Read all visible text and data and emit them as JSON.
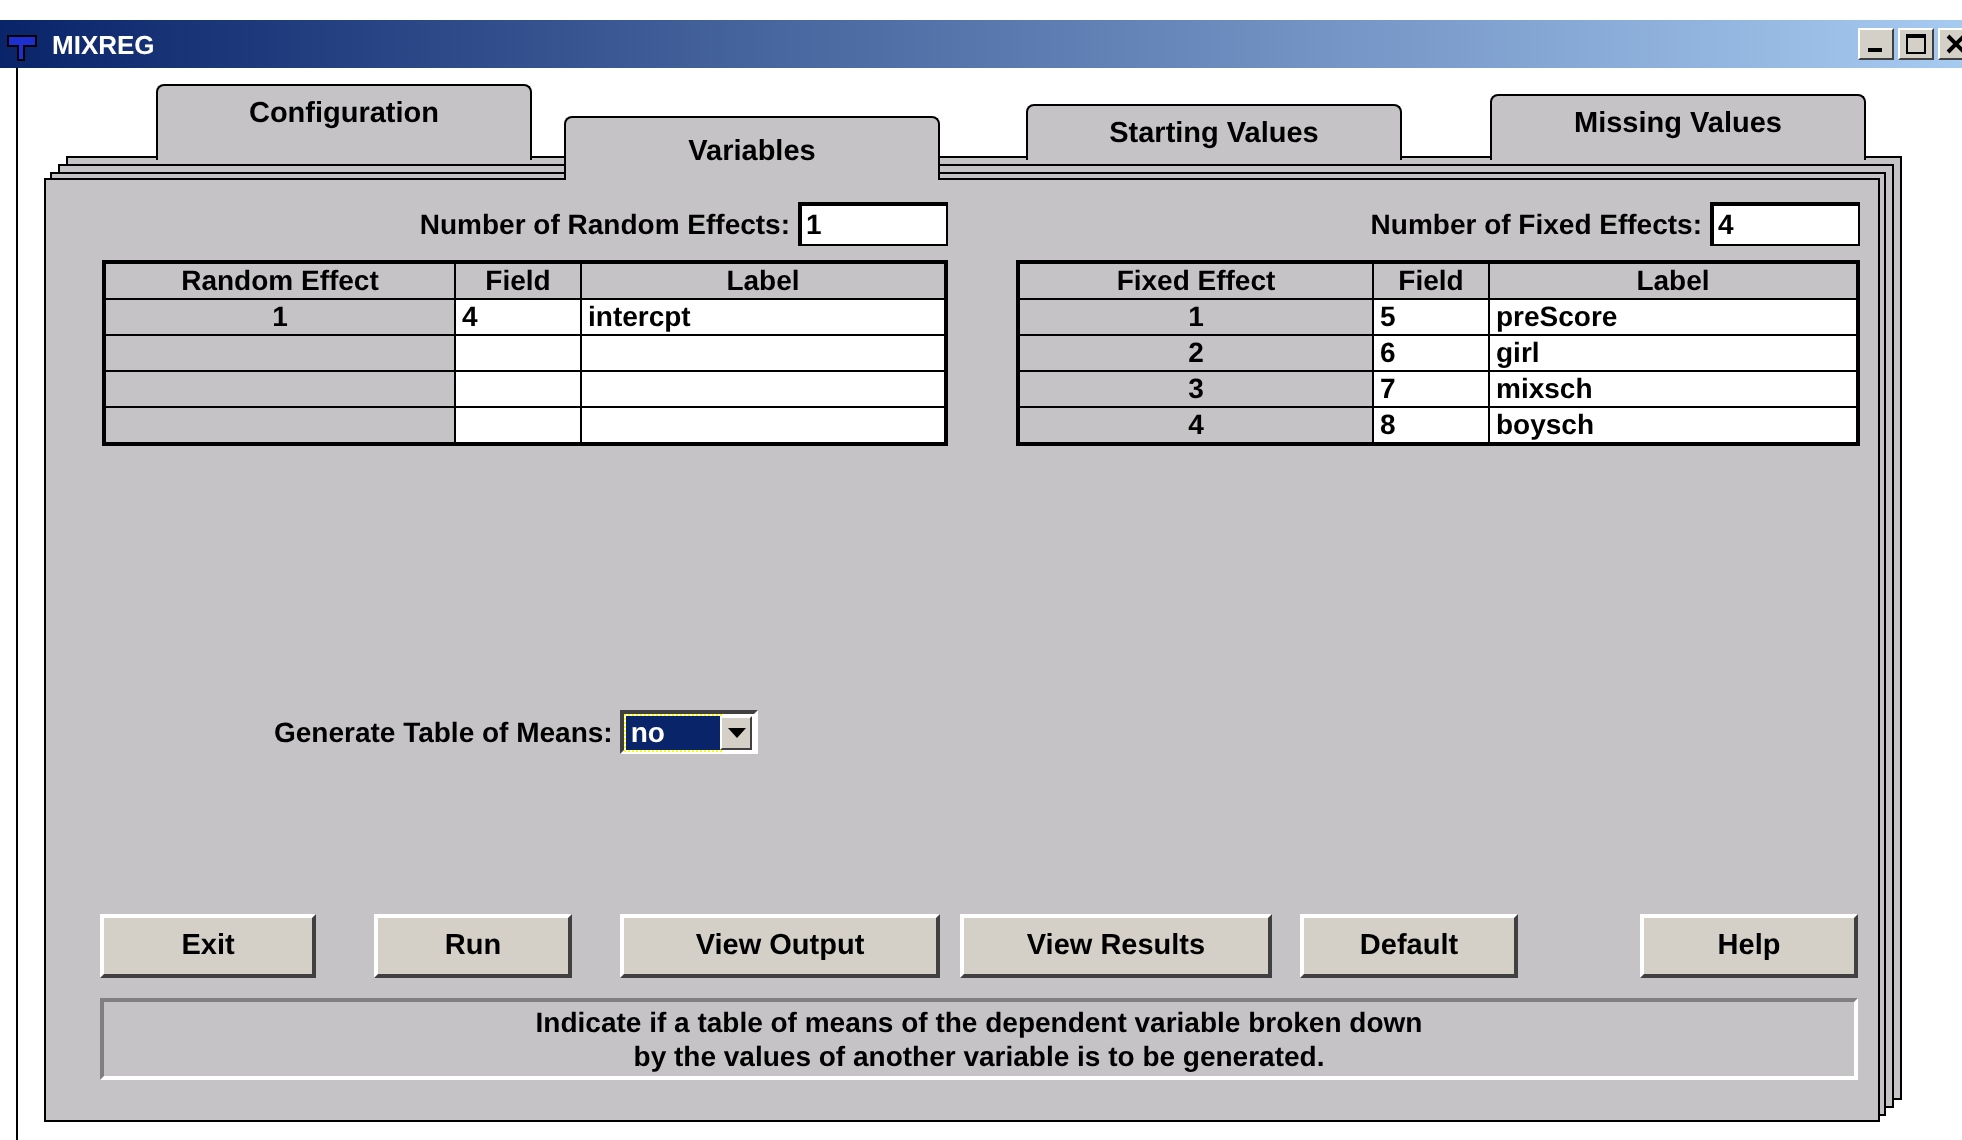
{
  "window": {
    "title": "MIXREG"
  },
  "tabs": [
    {
      "label": "Configuration",
      "selected": false
    },
    {
      "label": "Variables",
      "selected": true
    },
    {
      "label": "Starting Values",
      "selected": false
    },
    {
      "label": "Missing Values",
      "selected": false
    }
  ],
  "random_effects": {
    "count_label": "Number of Random Effects:",
    "count_value": "1",
    "columns": [
      "Random Effect",
      "Field",
      "Label"
    ],
    "rows": [
      {
        "effect": "1",
        "field": "4",
        "label": "intercpt"
      },
      {},
      {},
      {}
    ]
  },
  "fixed_effects": {
    "count_label": "Number of Fixed Effects:",
    "count_value": "4",
    "columns": [
      "Fixed Effect",
      "Field",
      "Label"
    ],
    "rows": [
      {
        "effect": "1",
        "field": "5",
        "label": "preScore"
      },
      {
        "effect": "2",
        "field": "6",
        "label": "girl"
      },
      {
        "effect": "3",
        "field": "7",
        "label": "mixsch"
      },
      {
        "effect": "4",
        "field": "8",
        "label": "boysch"
      }
    ]
  },
  "means": {
    "label": "Generate Table of Means:",
    "value": "no",
    "highlighted": true
  },
  "buttons": [
    "Exit",
    "Run",
    "View Output",
    "View Results",
    "Default",
    "Help"
  ],
  "status": [
    "Indicate if a table of means of the dependent variable broken down",
    "by the values of another variable is to be generated."
  ]
}
